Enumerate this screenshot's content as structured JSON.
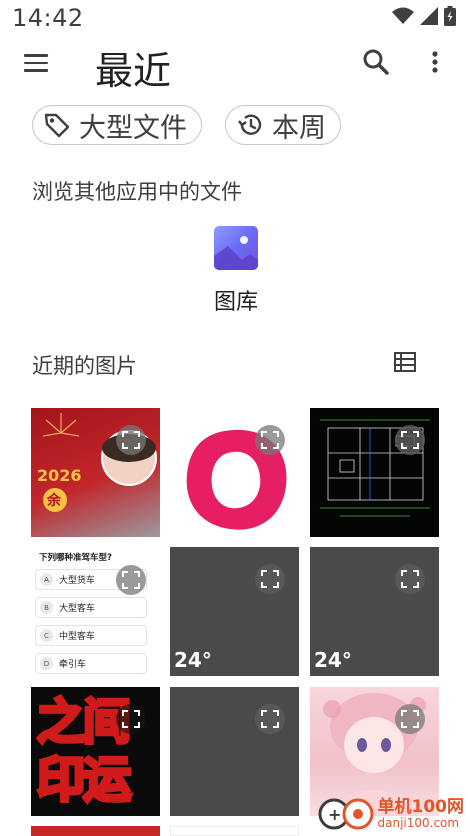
{
  "status_bar": {
    "time": "14:42"
  },
  "app_bar": {
    "title": "最近"
  },
  "chips": [
    {
      "label": "大型文件",
      "icon": "tag-icon"
    },
    {
      "label": "本周",
      "icon": "history-icon"
    }
  ],
  "browse_section": {
    "heading": "浏览其他应用中的文件"
  },
  "apps": [
    {
      "label": "图库",
      "icon": "gallery-icon"
    }
  ],
  "recent_section": {
    "heading": "近期的图片"
  },
  "tiles": {
    "t1_text": "2026",
    "t1_char": "余",
    "quiz_title": "下列哪种准驾车型?",
    "quiz_options": [
      {
        "letter": "A",
        "text": "大型货车"
      },
      {
        "letter": "B",
        "text": "大型客车"
      },
      {
        "letter": "C",
        "text": "中型客车"
      },
      {
        "letter": "D",
        "text": "牵引车"
      }
    ],
    "weather_1": "24°",
    "weather_2": "24°",
    "calligraphy_1": "之间",
    "calligraphy_2": "印运"
  },
  "watermark": {
    "main": "单机100网",
    "sub": "danji100.com"
  },
  "colors": {
    "accent_red": "#c62828",
    "pink": "#e91e63",
    "tile_dark": "#4a4a4a"
  }
}
